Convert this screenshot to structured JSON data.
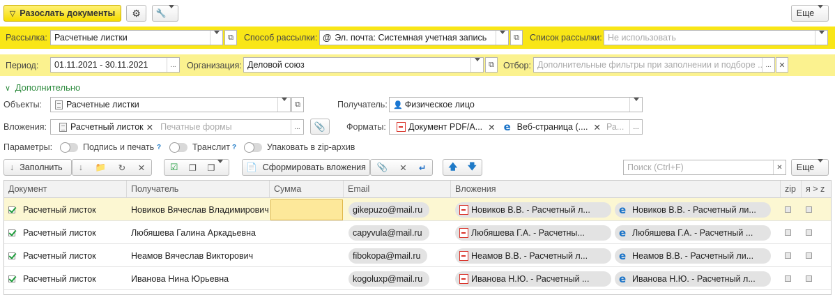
{
  "toolbar_top": {
    "send_label": "Разослать документы",
    "more_label": "Еще"
  },
  "mailing": {
    "label": "Рассылка:",
    "value": "Расчетные листки",
    "method_label": "Способ рассылки:",
    "method_value": "Эл. почта: Системная учетная запись",
    "list_label": "Список рассылки:",
    "list_placeholder": "Не использовать"
  },
  "period": {
    "label": "Период:",
    "value": "01.11.2021 - 30.11.2021",
    "org_label": "Организация:",
    "org_value": "Деловой союз",
    "filter_label": "Отбор:",
    "filter_placeholder": "Дополнительные фильтры при заполнении и подборе ..."
  },
  "additional": {
    "title": "Дополнительно",
    "objects_label": "Объекты:",
    "objects_value": "Расчетные листки",
    "recipient_label": "Получатель:",
    "recipient_value": "Физическое лицо",
    "attachments_label": "Вложения:",
    "attachment_chip": "Расчетный листок",
    "attachments_placeholder": "Печатные формы",
    "formats_label": "Форматы:",
    "format_pdf": "Документ PDF/A...",
    "format_web": "Веб-страница (....",
    "formats_placeholder": "Ра..."
  },
  "params": {
    "label": "Параметры:",
    "sign_label": "Подпись и печать",
    "translit_label": "Транслит",
    "zip_label": "Упаковать в zip-архив",
    "help_mark": "?"
  },
  "toolbar_table": {
    "fill_label": "Заполнить",
    "form_attachments_label": "Сформировать вложения",
    "search_placeholder": "Поиск (Ctrl+F)",
    "more_label": "Еще"
  },
  "table": {
    "columns": [
      "Документ",
      "Получатель",
      "Сумма",
      "Email",
      "Вложения",
      "zip",
      "я > z"
    ],
    "rows": [
      {
        "doc": "Расчетный листок",
        "recipient": "Новиков Вячеслав Владимирович",
        "sum": "",
        "email": "gikepuzo@mail.ru",
        "att_pdf": "Новиков В.В. - Расчетный л...",
        "att_web": "Новиков В.В. - Расчетный ли..."
      },
      {
        "doc": "Расчетный листок",
        "recipient": "Любяшева Галина Аркадьевна",
        "sum": "",
        "email": "capyvula@mail.ru",
        "att_pdf": "Любяшева Г.А. - Расчетны...",
        "att_web": "Любяшева Г.А. - Расчетный ..."
      },
      {
        "doc": "Расчетный листок",
        "recipient": "Неамов Вячеслав Викторович",
        "sum": "",
        "email": "fibokopa@mail.ru",
        "att_pdf": "Неамов В.В. - Расчетный л...",
        "att_web": "Неамов В.В. - Расчетный ли..."
      },
      {
        "doc": "Расчетный листок",
        "recipient": "Иванова Нина Юрьевна",
        "sum": "",
        "email": "kogoluxp@mail.ru",
        "att_pdf": "Иванова Н.Ю. - Расчетный ...",
        "att_web": "Иванова Н.Ю. - Расчетный л..."
      }
    ]
  },
  "colors": {
    "accent_yellow": "#f9e617",
    "row_selected": "#fcf7d2",
    "green_link": "#2e8b3e"
  }
}
